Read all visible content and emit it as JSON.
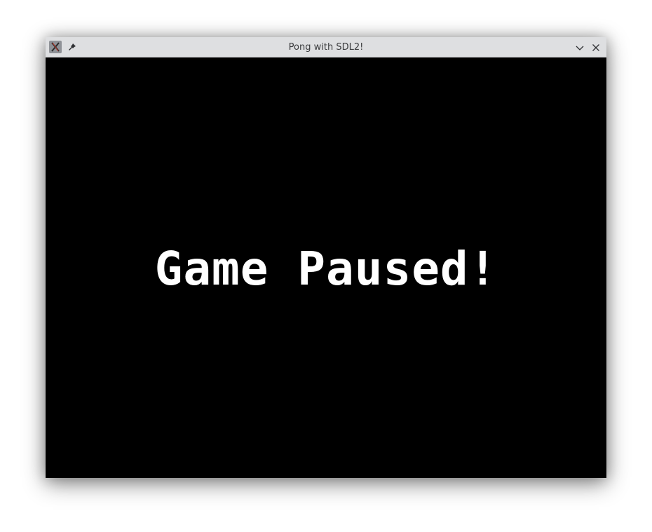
{
  "window": {
    "title": "Pong with SDL2!",
    "icons": {
      "app": "x-app-icon",
      "pin": "pin-icon",
      "minimize": "chevron-down-icon",
      "close": "close-icon"
    }
  },
  "game": {
    "message": "Game Paused!",
    "background_color": "#000000",
    "text_color": "#ffffff"
  }
}
